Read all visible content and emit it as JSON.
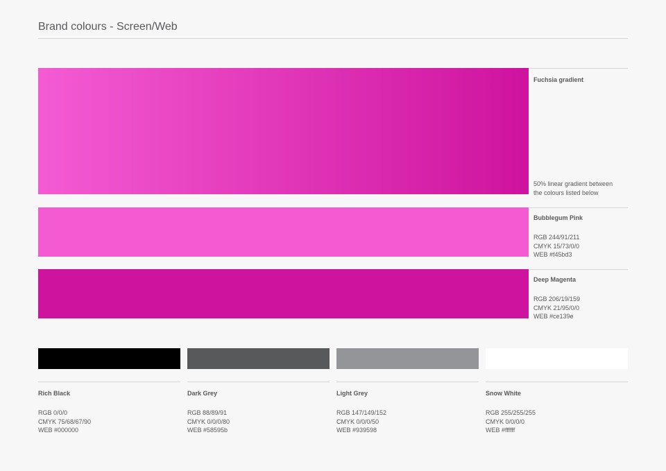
{
  "title": "Brand colours - Screen/Web",
  "gradient": {
    "name": "Fuchsia gradient",
    "description_line1": "50% linear gradient between",
    "description_line2": "the colours listed below",
    "from_color": "#f45bd3",
    "to_color": "#ce139e"
  },
  "main_colours": [
    {
      "name": "Bubblegum Pink",
      "rgb": "RGB 244/91/211",
      "cmyk": "CMYK 15/73/0/0",
      "web": "WEB #f45bd3",
      "color": "#f45bd3"
    },
    {
      "name": "Deep Magenta",
      "rgb": "RGB 206/19/159",
      "cmyk": "CMYK 21/95/0/0",
      "web": "WEB #ce139e",
      "color": "#ce139e"
    }
  ],
  "neutral_colours": [
    {
      "name": "Rich Black",
      "rgb": "RGB 0/0/0",
      "cmyk": "CMYK 75/68/67/90",
      "web": "WEB #000000",
      "color": "#000000"
    },
    {
      "name": "Dark Grey",
      "rgb": "RGB 88/89/91",
      "cmyk": "CMYK 0/0/0/80",
      "web": "WEB #58595b",
      "color": "#58595b"
    },
    {
      "name": "Light Grey",
      "rgb": "RGB 147/149/152",
      "cmyk": "CMYK 0/0/0/50",
      "web": "WEB #939598",
      "color": "#939598"
    },
    {
      "name": "Snow White",
      "rgb": "RGB 255/255/255",
      "cmyk": "CMYK 0/0/0/0",
      "web": "WEB #ffffff",
      "color": "#ffffff"
    }
  ]
}
